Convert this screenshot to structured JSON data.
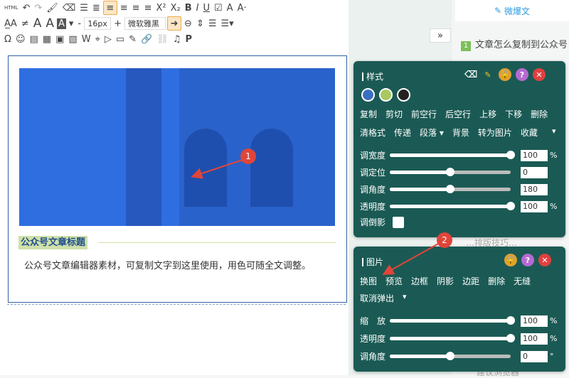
{
  "toolbar": {
    "html_label": "HTML",
    "font_size": "16px",
    "font_family": "微软雅黑",
    "minus": "-",
    "plus": "+"
  },
  "article": {
    "title": "公众号文章标题",
    "body": "公众号文章编辑器素材，可复制文字到这里使用，用色可随全文调整。"
  },
  "markers": {
    "one": "1",
    "two": "2"
  },
  "sidebar": {
    "weibao": "微爆文",
    "expand": "»",
    "article_num": "1",
    "article_title": "文章怎么复制到公众号",
    "frag1": "…排版技巧…",
    "frag2": "建议浏览器"
  },
  "style_panel": {
    "title": "样式",
    "colors": [
      "#3a6ec2",
      "#a7c95e",
      "#222222"
    ],
    "row1": [
      "复制",
      "剪切",
      "前空行",
      "后空行",
      "上移",
      "下移",
      "删除"
    ],
    "row2": [
      "清格式",
      "传递",
      "段落 ▾",
      "背景",
      "转为图片",
      "收藏"
    ],
    "row2_arrow": "▾",
    "sliders": [
      {
        "label": "调宽度",
        "value": "100",
        "unit": "%",
        "pos": 1.0
      },
      {
        "label": "调定位",
        "value": "0",
        "unit": "",
        "pos": 0.5
      },
      {
        "label": "调角度",
        "value": "180",
        "unit": "",
        "pos": 0.5
      },
      {
        "label": "透明度",
        "value": "100",
        "unit": "%",
        "pos": 1.0
      }
    ],
    "reflect_label": "调倒影"
  },
  "image_panel": {
    "title": "图片",
    "row1": [
      "换图",
      "预览",
      "边框",
      "阴影",
      "边距",
      "删除",
      "无缝"
    ],
    "row2": "取消弹出",
    "row2_arrow": "▾",
    "sliders": [
      {
        "label": "缩　放",
        "value": "100",
        "unit": "%",
        "pos": 1.0
      },
      {
        "label": "透明度",
        "value": "100",
        "unit": "%",
        "pos": 1.0
      },
      {
        "label": "调角度",
        "value": "0",
        "unit": "°",
        "pos": 0.5
      }
    ]
  },
  "icons": {
    "weibao": "edit-icon",
    "eraser": "eraser-icon",
    "pencil": "pencil-icon",
    "lock": "lock-icon",
    "help": "help-icon",
    "close": "close-icon"
  }
}
